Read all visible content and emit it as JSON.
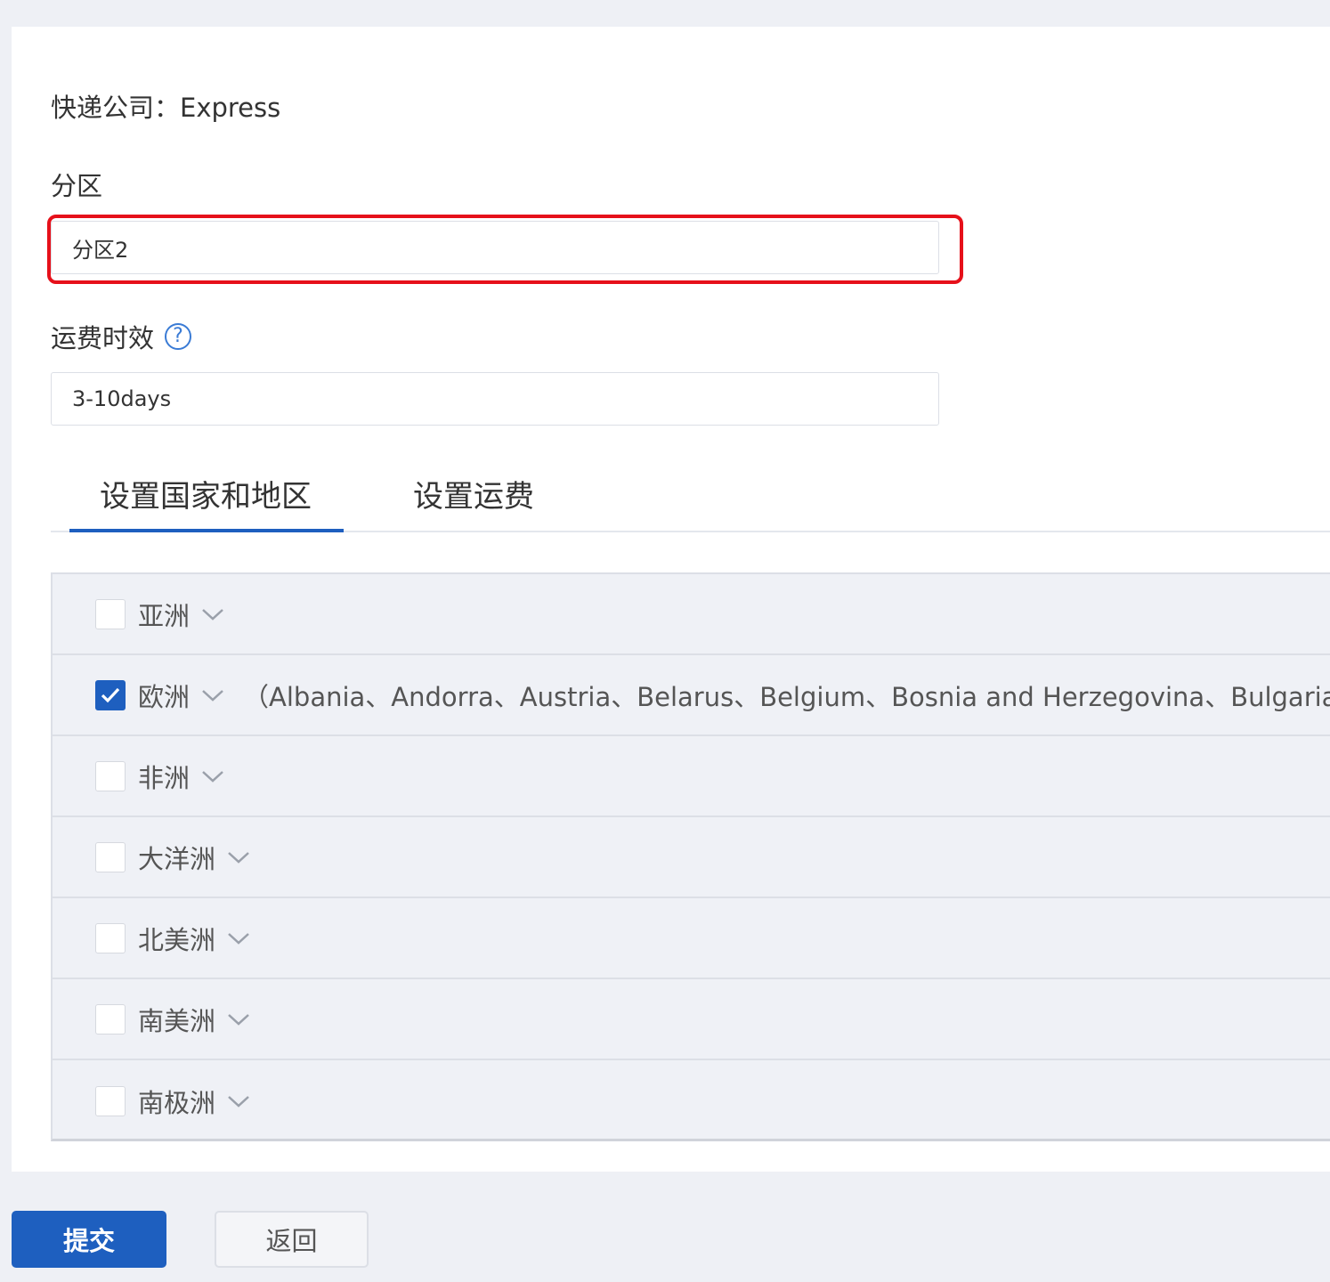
{
  "form": {
    "carrier_label": "快递公司：Express",
    "zone_label": "分区",
    "zone_value": "分区2",
    "shipping_time_label": "运费时效",
    "help_icon": "question-circle-icon",
    "shipping_time_value": "3-10days"
  },
  "tabs": [
    {
      "label": "设置国家和地区",
      "active": true
    },
    {
      "label": "设置运费",
      "active": false
    }
  ],
  "regions": [
    {
      "name": "亚洲",
      "checked": false,
      "countries": ""
    },
    {
      "name": "欧洲",
      "checked": true,
      "countries": "（Albania、Andorra、Austria、Belarus、Belgium、Bosnia and Herzegovina、Bulgaria、"
    },
    {
      "name": "非洲",
      "checked": false,
      "countries": ""
    },
    {
      "name": "大洋洲",
      "checked": false,
      "countries": ""
    },
    {
      "name": "北美洲",
      "checked": false,
      "countries": ""
    },
    {
      "name": "南美洲",
      "checked": false,
      "countries": ""
    },
    {
      "name": "南极洲",
      "checked": false,
      "countries": ""
    }
  ],
  "actions": {
    "submit_label": "提交",
    "back_label": "返回"
  },
  "colors": {
    "primary": "#1e5fbf",
    "highlight": "#e6101a",
    "background": "#eef0f5"
  }
}
